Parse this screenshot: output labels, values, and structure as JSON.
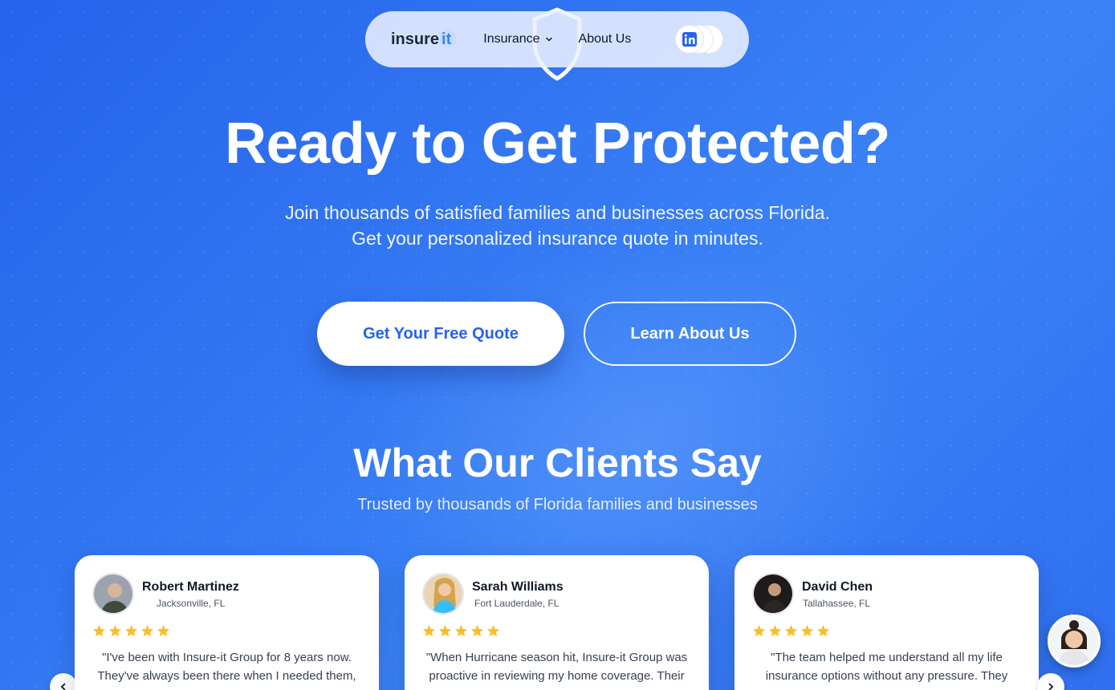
{
  "nav": {
    "logo_part1": "insure",
    "logo_part2": "it",
    "insurance_label": "Insurance",
    "about_label": "About Us",
    "socials": [
      "linkedin-icon",
      "instagram-icon",
      "facebook-icon"
    ]
  },
  "hero": {
    "title": "Ready to Get Protected?",
    "subtitle_line1": "Join thousands of satisfied families and businesses across Florida.",
    "subtitle_line2": "Get your personalized insurance quote in minutes.",
    "primary_button": "Get Your Free Quote",
    "secondary_button": "Learn About Us"
  },
  "testimonials": {
    "title": "What Our Clients Say",
    "subtitle": "Trusted by thousands of Florida families and businesses",
    "cards": [
      {
        "name": "Robert Martinez",
        "location": "Jacksonville, FL",
        "rating": 5,
        "quote": "\"I've been with Insure-it Group for 8 years now. They've always been there when I needed them,"
      },
      {
        "name": "Sarah Williams",
        "location": "Fort Lauderdale, FL",
        "rating": 5,
        "quote": "\"When Hurricane season hit, Insure-it Group was proactive in reviewing my home coverage. Their"
      },
      {
        "name": "David Chen",
        "location": "Tallahassee, FL",
        "rating": 5,
        "quote": "\"The team helped me understand all my life insurance options without any pressure. They"
      }
    ]
  },
  "colors": {
    "background": "#2563eb",
    "accent": "#3b82f6",
    "star": "#fbbf24"
  }
}
